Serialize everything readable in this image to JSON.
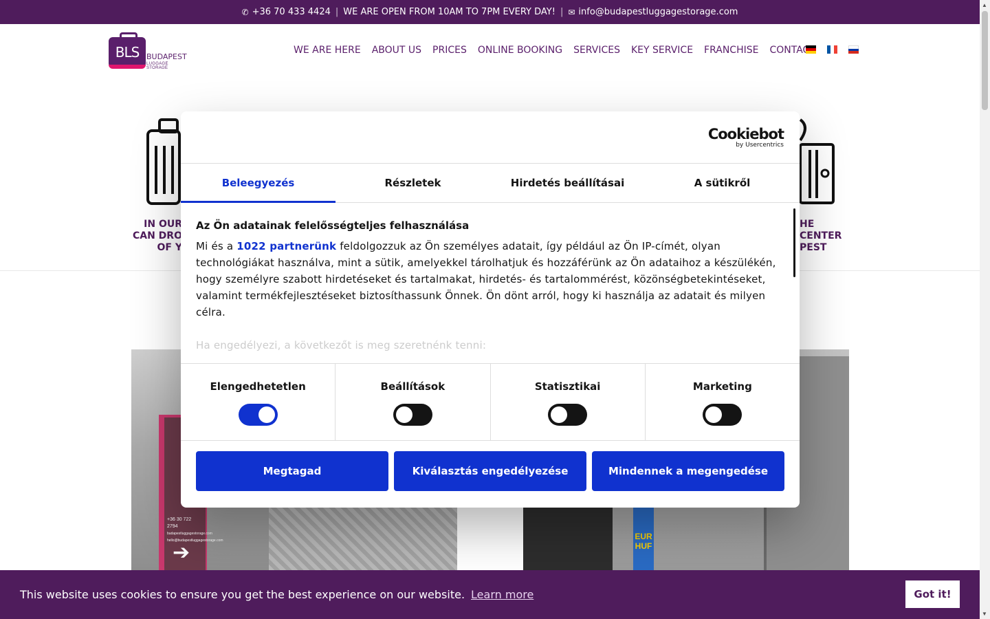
{
  "topbar": {
    "phone": "+36 70 433 4424",
    "hours": "WE ARE OPEN FROM 10AM TO 7PM EVERY DAY!",
    "email": "info@budapestluggagestorage.com",
    "icons": [
      "phone-icon",
      "envelope-icon"
    ]
  },
  "logo": {
    "letters": "BLS",
    "name": "BUDAPEST",
    "subtitle": "LUGGAGE STORAGE"
  },
  "nav": {
    "items": [
      {
        "label": "WE ARE HERE"
      },
      {
        "label": "ABOUT US"
      },
      {
        "label": "PRICES"
      },
      {
        "label": "ONLINE BOOKING"
      },
      {
        "label": "SERVICES"
      },
      {
        "label": "KEY SERVICE"
      },
      {
        "label": "FRANCHISE"
      },
      {
        "label": "CONTACT"
      }
    ],
    "flags": [
      "german-flag",
      "french-flag",
      "russian-flag"
    ]
  },
  "features": {
    "left_text": "IN OUR\nCAN DRO\nOF Y",
    "right_text": "HE CENTER\nPEST"
  },
  "photos": {
    "sign_phone": "+36 30 722 2794",
    "sign_site": "budapestluggagestorage.com",
    "sign_email": "hello@budapestluggagestorage.com",
    "euro_label": "EUR HUF"
  },
  "cookiebot": {
    "brand": "Cookiebot",
    "brand_sub": "by Usercentrics",
    "tabs": [
      {
        "label": "Beleegyezés",
        "active": true
      },
      {
        "label": "Részletek",
        "active": false
      },
      {
        "label": "Hirdetés beállításai",
        "active": false
      },
      {
        "label": "A sütikről",
        "active": false
      }
    ],
    "heading": "Az Ön adatainak felelősségteljes felhasználása",
    "body_prefix": "Mi és a",
    "partner_link": "1022 partnerünk",
    "body_rest": "feldolgozzuk az Ön személyes adatait, így például az Ön IP-címét, olyan technológiákat használva, mint a sütik, amelyekkel tárolhatjuk és hozzáférünk az Ön adataihoz a készülékén, hogy személyre szabott hirdetéseket és tartalmakat, hirdetés- és tartalommérést, közönségbetekintéseket, valamint termékfejlesztéseket biztosíthassunk Önnek. Ön dönt arról, hogy ki használja az adatait és milyen célra.",
    "body_fade": "Ha engedélyezi, a következőt is meg szeretnénk tenni:",
    "toggles": [
      {
        "label": "Elengedhetetlen",
        "on": true
      },
      {
        "label": "Beállítások",
        "on": false
      },
      {
        "label": "Statisztikai",
        "on": false
      },
      {
        "label": "Marketing",
        "on": false
      }
    ],
    "buttons": {
      "deny": "Megtagad",
      "allow_selection": "Kiválasztás engedélyezése",
      "allow_all": "Mindennek a megengedése"
    },
    "accent": "#1032cf"
  },
  "banner": {
    "message": "This website uses cookies to ensure you get the best experience on our website.",
    "learn_more": "Learn more",
    "got_it": "Got it!"
  },
  "colors": {
    "brand_purple": "#4f1c5c",
    "brand_pink": "#e0156d"
  }
}
